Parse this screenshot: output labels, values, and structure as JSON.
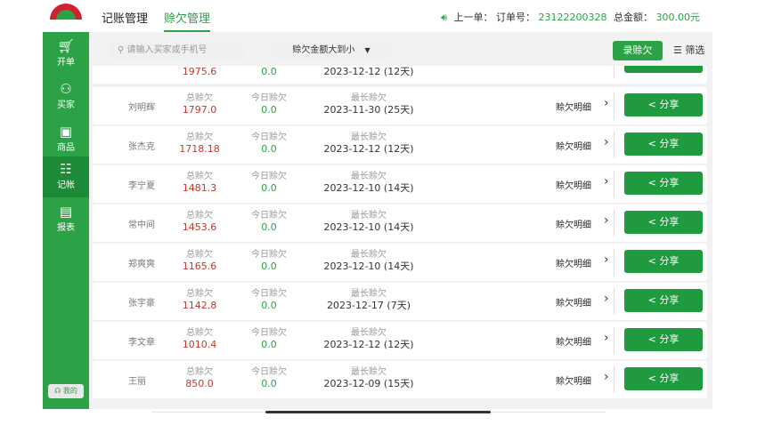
{
  "header": {
    "tabs": [
      {
        "label": "记账管理"
      },
      {
        "label": "赊欠管理"
      }
    ],
    "last_order_label": "上一单：",
    "order_no_label": "订单号：",
    "order_no": "23122200328",
    "total_label": "总金额：",
    "total": "300.00元"
  },
  "sidebar": {
    "items": [
      {
        "label": "开单",
        "icon": "cart-icon"
      },
      {
        "label": "买家",
        "icon": "user-icon"
      },
      {
        "label": "商品",
        "icon": "bag-icon"
      },
      {
        "label": "记帐",
        "icon": "ledger-icon"
      },
      {
        "label": "报表",
        "icon": "chart-icon"
      }
    ],
    "my_label": "我的"
  },
  "toolbar": {
    "search_placeholder": "请输入买家或手机号",
    "sort_label": "赊欠金额大到小",
    "record_button": "录赊欠",
    "filter_label": "筛选"
  },
  "list": {
    "col_total": "总赊欠",
    "col_today": "今日赊欠",
    "col_longest": "最长赊欠",
    "detail_label": "赊欠明细",
    "share_label": "分享",
    "partial": {
      "total": "1975.6",
      "today": "0.0",
      "longest": "2023-12-12 (12天)"
    },
    "rows": [
      {
        "name": "刘明辉",
        "total": "1797.0",
        "today": "0.0",
        "longest": "2023-11-30 (25天)"
      },
      {
        "name": "张杰克",
        "total": "1718.18",
        "today": "0.0",
        "longest": "2023-12-12 (12天)"
      },
      {
        "name": "李宁夏",
        "total": "1481.3",
        "today": "0.0",
        "longest": "2023-12-10 (14天)"
      },
      {
        "name": "常中间",
        "total": "1453.6",
        "today": "0.0",
        "longest": "2023-12-10 (14天)"
      },
      {
        "name": "郑爽爽",
        "total": "1165.6",
        "today": "0.0",
        "longest": "2023-12-10 (14天)"
      },
      {
        "name": "张宇豪",
        "total": "1142.8",
        "today": "0.0",
        "longest": "2023-12-17 (7天)"
      },
      {
        "name": "李文章",
        "total": "1010.4",
        "today": "0.0",
        "longest": "2023-12-12 (12天)"
      },
      {
        "name": "王丽",
        "total": "850.0",
        "today": "0.0",
        "longest": "2023-12-09 (15天)"
      }
    ]
  }
}
